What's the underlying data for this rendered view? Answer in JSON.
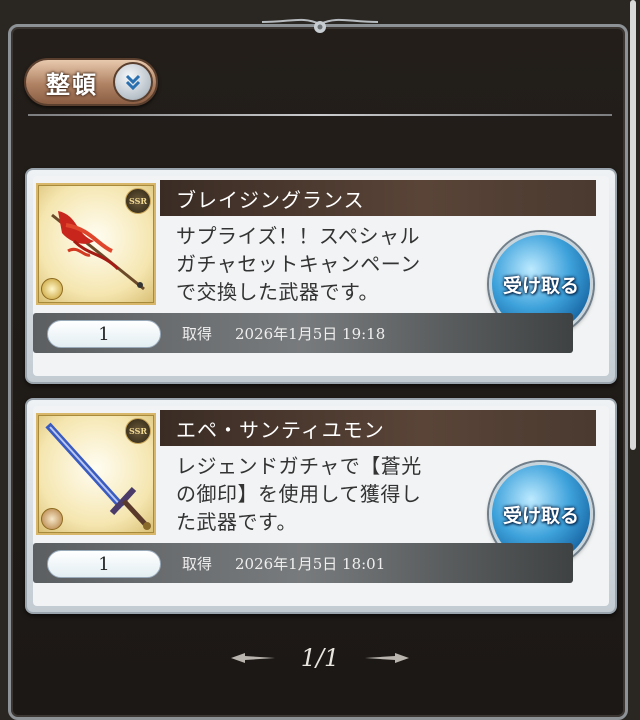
{
  "toolbar": {
    "sort_label": "整頓",
    "sort_icon": "double-chevron-down-icon"
  },
  "items": [
    {
      "name": "ブレイジングランス",
      "description": "サプライズ！！スペシャル\nガチャセットキャンペーン\nで交換した武器です。",
      "rarity": "SSR",
      "quantity": "1",
      "obtain_label": "取得",
      "obtained_at": "2026年1月5日 19:18",
      "receive_label": "受け取る"
    },
    {
      "name": "エペ・サンティユモン",
      "description": "レジェンドガチャで【蒼光\nの御印】を使用して獲得し\nた武器です。",
      "rarity": "SSR",
      "quantity": "1",
      "obtain_label": "取得",
      "obtained_at": "2026年1月5日 18:01",
      "receive_label": "受け取る"
    }
  ],
  "pagination": {
    "label": "1/1"
  },
  "colors": {
    "receive_button": "#3ea2db",
    "background": "#231e1a"
  }
}
